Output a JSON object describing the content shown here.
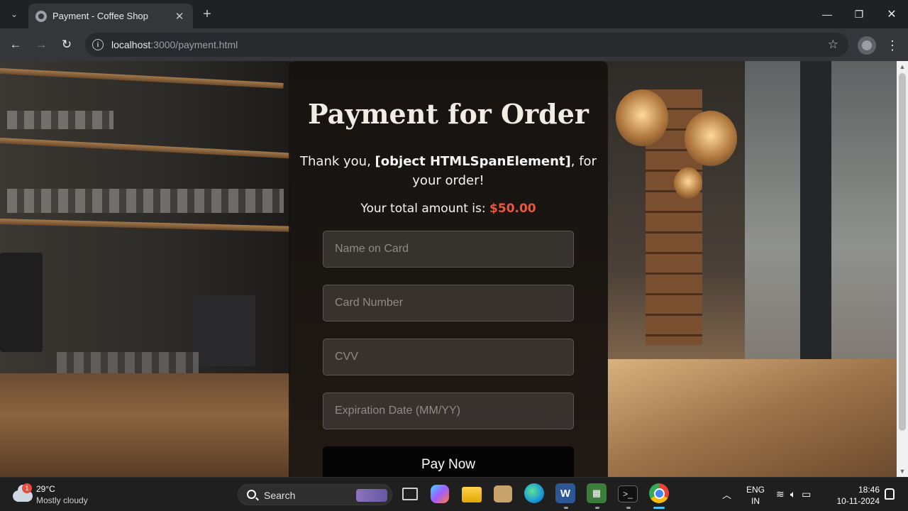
{
  "browser": {
    "tab_title": "Payment - Coffee Shop",
    "url_host": "localhost",
    "url_rest": ":3000/payment.html"
  },
  "page": {
    "title": "Payment for Order",
    "thanks_prefix": "Thank you, ",
    "customer_name": "[object HTMLSpanElement]",
    "thanks_suffix": ", for your order!",
    "total_label": "Your total amount is: ",
    "total_amount": "$50.00",
    "fields": {
      "name_placeholder": "Name on Card",
      "card_placeholder": "Card Number",
      "cvv_placeholder": "CVV",
      "expiry_placeholder": "Expiration Date (MM/YY)"
    },
    "pay_button": "Pay Now",
    "accent_color": "#f0543a"
  },
  "taskbar": {
    "weather_badge": "1",
    "temperature": "29°C",
    "condition": "Mostly cloudy",
    "search_label": "Search",
    "lang_line1": "ENG",
    "lang_line2": "IN",
    "time": "18:46",
    "date": "10-11-2024"
  }
}
